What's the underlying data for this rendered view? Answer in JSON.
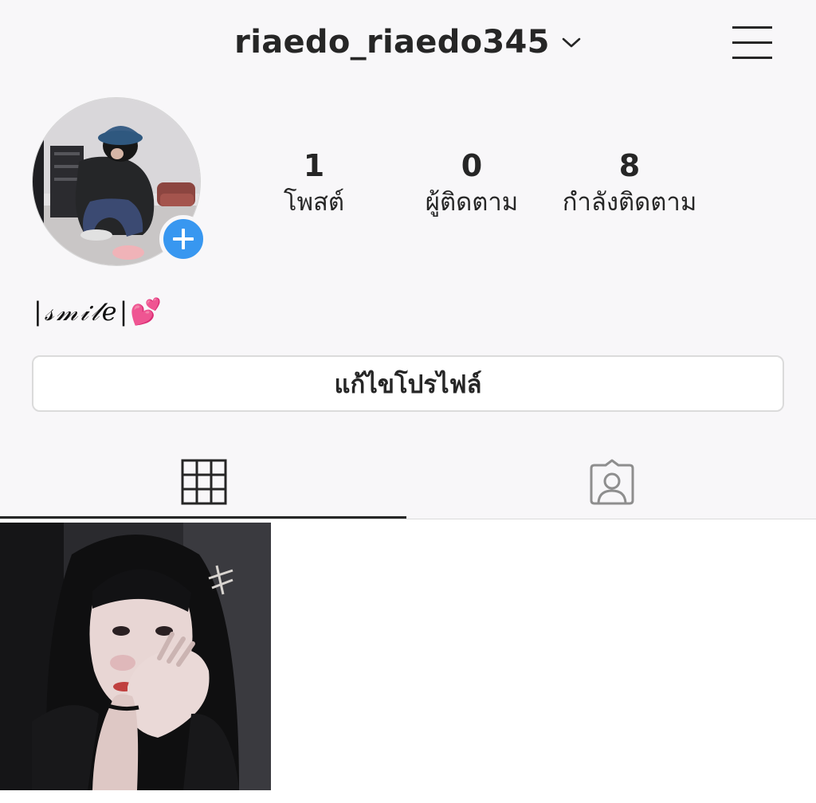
{
  "header": {
    "username": "riaedo_riaedo345",
    "switch_account_icon": "chevron-down-icon",
    "menu_icon": "hamburger-menu-icon"
  },
  "profile": {
    "add_story_icon": "plus-icon",
    "bio": "|𝓈𝓂𝒾𝓁𝑒|",
    "bio_emoji": "💕"
  },
  "stats": [
    {
      "value": "1",
      "label": "โพสต์"
    },
    {
      "value": "0",
      "label": "ผู้ติดตาม"
    },
    {
      "value": "8",
      "label": "กำลังติดตาม"
    }
  ],
  "actions": {
    "edit_profile_label": "แก้ไขโปรไฟล์"
  },
  "tabs": [
    {
      "icon": "grid-icon",
      "active": true
    },
    {
      "icon": "tagged-person-icon",
      "active": false
    }
  ],
  "colors": {
    "background": "#f8f7f9",
    "text": "#262626",
    "accent": "#3897f0",
    "border": "#dbdbdb",
    "tab_inactive": "#8e8e8e"
  }
}
